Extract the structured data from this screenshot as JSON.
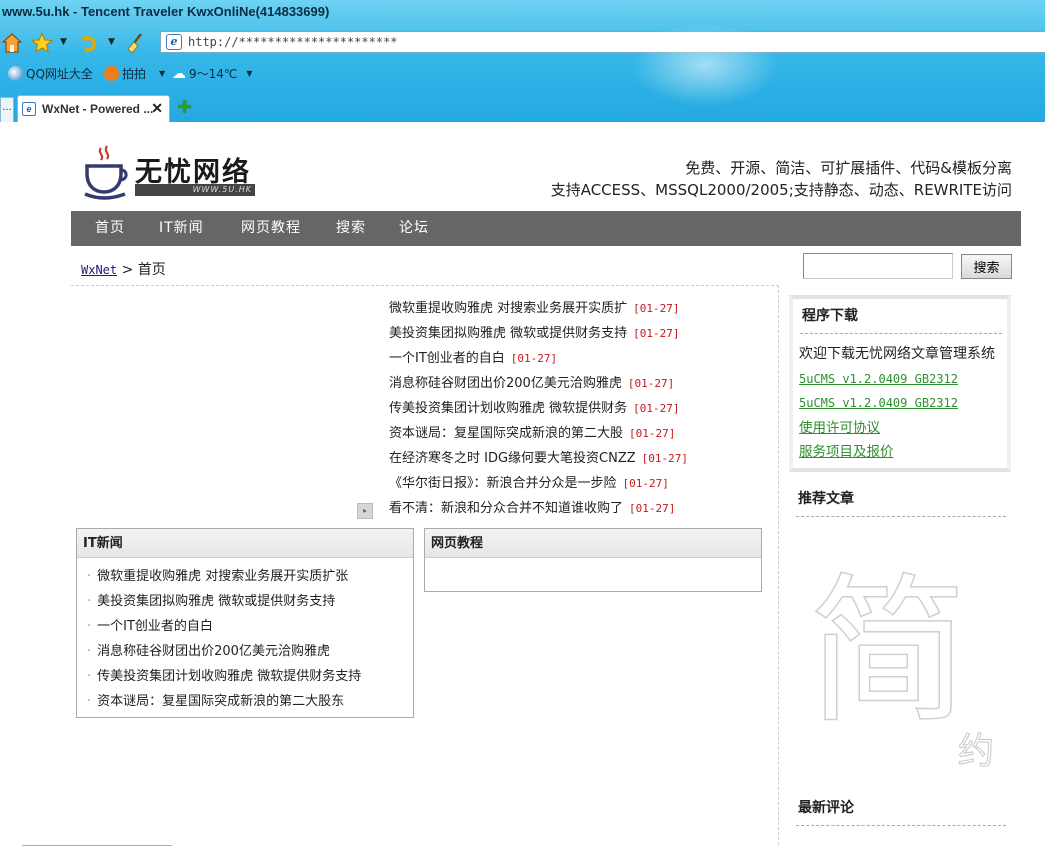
{
  "browser": {
    "window_title": "www.5u.hk - Tencent Traveler  KwxOnliNe(414833699)",
    "address": "http://**********************",
    "links": [
      {
        "label": "QQ网址大全",
        "icon": "qq-search-icon"
      },
      {
        "label": "拍拍",
        "icon": "paipai-icon"
      },
      {
        "label": "9～14℃",
        "icon": "weather-icon"
      }
    ],
    "tab_label": "WxNet - Powered ...",
    "tab_stub": "..."
  },
  "site": {
    "logo_text": "无忧网络",
    "logo_sub": "WWW.5U.HK",
    "slogan_line1": "免费、开源、简洁、可扩展插件、代码&模板分离",
    "slogan_line2": "支持ACCESS、MSSQL2000/2005;支持静态、动态、REWRITE访问",
    "nav": [
      "首页",
      "IT新闻",
      "网页教程",
      "搜索",
      "论坛"
    ],
    "breadcrumb_home": "WxNet",
    "breadcrumb_sep": ">",
    "breadcrumb_current": "首页",
    "search_button": "搜索"
  },
  "headlines": [
    {
      "title": "微软重提收购雅虎 对搜索业务展开实质扩",
      "date": "[01-27]"
    },
    {
      "title": "美投资集团拟购雅虎 微软或提供财务支持",
      "date": "[01-27]"
    },
    {
      "title": "一个IT创业者的自白",
      "date": "[01-27]"
    },
    {
      "title": "消息称硅谷财团出价200亿美元洽购雅虎",
      "date": "[01-27]"
    },
    {
      "title": "传美投资集团计划收购雅虎 微软提供财务",
      "date": "[01-27]"
    },
    {
      "title": "资本谜局：复星国际突成新浪的第二大股",
      "date": "[01-27]"
    },
    {
      "title": "在经济寒冬之时 IDG缘何要大笔投资CNZZ",
      "date": "[01-27]"
    },
    {
      "title": "《华尔街日报》：新浪合并分众是一步险",
      "date": "[01-27]"
    },
    {
      "title": "看不清：新浪和分众合并不知道谁收购了",
      "date": "[01-27]"
    }
  ],
  "it_news": {
    "title": "IT新闻",
    "items": [
      "微软重提收购雅虎 对搜索业务展开实质扩张",
      "美投资集团拟购雅虎 微软或提供财务支持",
      "一个IT创业者的自白",
      "消息称硅谷财团出价200亿美元洽购雅虎",
      "传美投资集团计划收购雅虎 微软提供财务支持",
      "资本谜局：复星国际突成新浪的第二大股东"
    ]
  },
  "tutorials": {
    "title": "网页教程"
  },
  "sidebar": {
    "downloads": {
      "title": "程序下载",
      "intro": "欢迎下载无忧网络文章管理系统",
      "links": [
        "5uCMS v1.2.0409 GB2312",
        "5uCMS v1.2.0409 GB2312",
        "使用许可协议",
        "服务项目及报价"
      ]
    },
    "recommended_title": "推荐文章",
    "watermark_big": "简",
    "watermark_small": "约",
    "latest_comments_title": "最新评论"
  }
}
